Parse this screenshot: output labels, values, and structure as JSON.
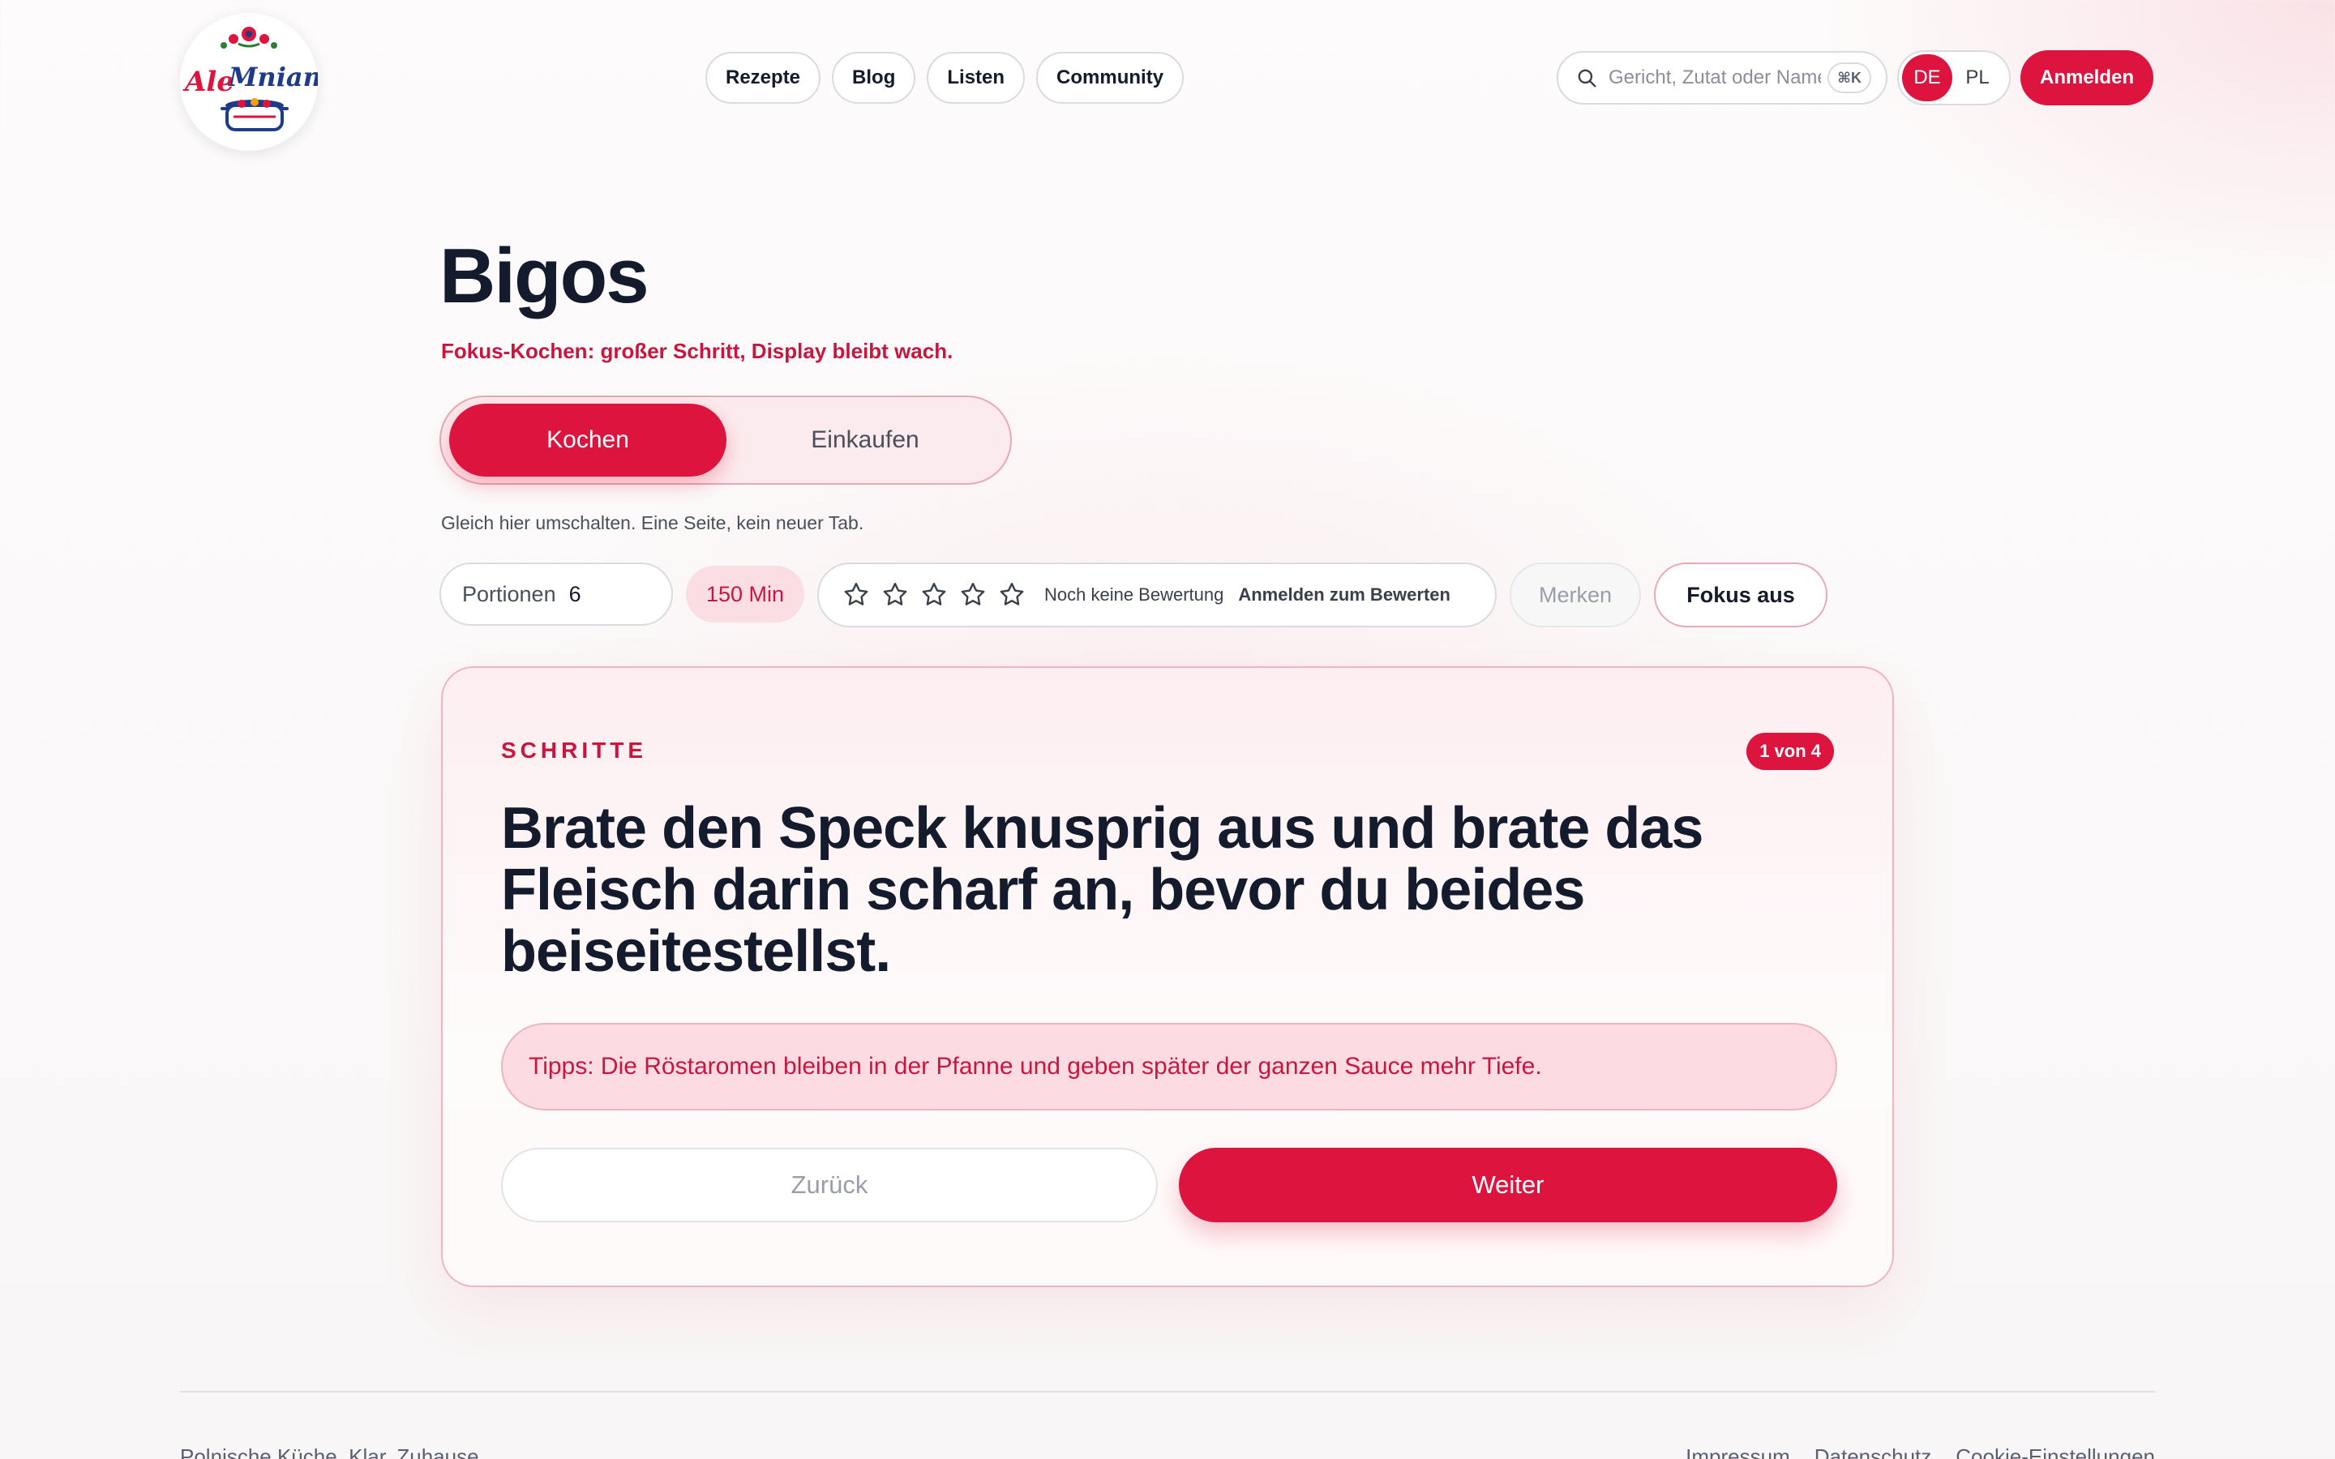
{
  "brand": {
    "logo_text_1": "Ale",
    "logo_text_2": "Mniam",
    "accent_color": "#dd143e"
  },
  "nav": {
    "items": [
      {
        "label": "Rezepte"
      },
      {
        "label": "Blog"
      },
      {
        "label": "Listen"
      },
      {
        "label": "Community"
      }
    ]
  },
  "search": {
    "placeholder": "Gericht, Zutat oder Name",
    "shortcut": "⌘K",
    "icon": "search-icon"
  },
  "language": {
    "options": [
      "DE",
      "PL"
    ],
    "selected": "DE"
  },
  "header": {
    "login_label": "Anmelden"
  },
  "recipe": {
    "title": "Bigos",
    "subtitle": "Fokus-Kochen: großer Schritt, Display bleibt wach."
  },
  "mode": {
    "cook_label": "Kochen",
    "shop_label": "Einkaufen",
    "selected": "Kochen",
    "helper": "Gleich hier umschalten. Eine Seite, kein neuer Tab."
  },
  "controls": {
    "portions_label": "Portionen",
    "portions_value": "6",
    "time": "150 Min",
    "rating_stars": 0,
    "rating_text": "Noch keine Bewertung",
    "rating_link": "Anmelden zum Bewerten",
    "save_label": "Merken",
    "focus_label": "Fokus aus"
  },
  "steps": {
    "label": "SCHRITTE",
    "counter": "1 von 4",
    "text": "Brate den Speck knusprig aus und brate das Fleisch darin scharf an, bevor du beides beiseitestellst.",
    "tip": "Tipps: Die Röstaromen bleiben in der Pfanne und geben später der ganzen Sauce mehr Tiefe.",
    "back_label": "Zurück",
    "next_label": "Weiter"
  },
  "footer": {
    "tagline": "Polnische Küche. Klar. Zuhause.",
    "links": [
      {
        "label": "Impressum"
      },
      {
        "label": "Datenschutz"
      },
      {
        "label": "Cookie-Einstellungen"
      }
    ]
  }
}
